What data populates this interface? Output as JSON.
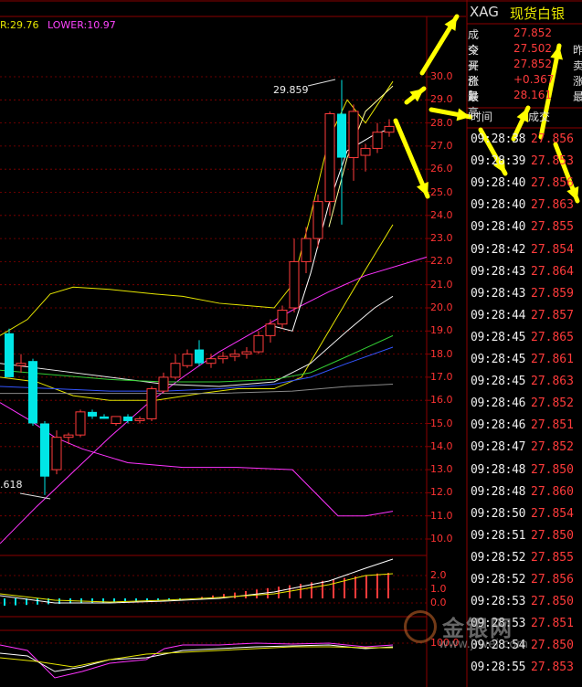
{
  "indicator_legend": {
    "upper": "R:29.76",
    "lower": "LOWER:10.97"
  },
  "header": {
    "code": "XAG",
    "name": "现货白银"
  },
  "quote": [
    {
      "label": "成交",
      "value": "27.852",
      "right": ""
    },
    {
      "label": "今开",
      "value": "27.502",
      "right": "昨"
    },
    {
      "label": "买价1",
      "value": "27.852",
      "right": "卖"
    },
    {
      "label": "涨跌",
      "value": "+0.367",
      "right": "涨"
    },
    {
      "label": "最高",
      "value": "28.161",
      "right": "最"
    }
  ],
  "tick_header": {
    "time": "时间",
    "trade": "成交"
  },
  "ticks": [
    {
      "time": "09:28:38",
      "price": "27.856"
    },
    {
      "time": "09:28:39",
      "price": "27.853"
    },
    {
      "time": "09:28:40",
      "price": "27.856"
    },
    {
      "time": "09:28:40",
      "price": "27.863"
    },
    {
      "time": "09:28:40",
      "price": "27.855"
    },
    {
      "time": "09:28:42",
      "price": "27.854"
    },
    {
      "time": "09:28:43",
      "price": "27.864"
    },
    {
      "time": "09:28:43",
      "price": "27.859"
    },
    {
      "time": "09:28:44",
      "price": "27.857"
    },
    {
      "time": "09:28:45",
      "price": "27.865"
    },
    {
      "time": "09:28:45",
      "price": "27.861"
    },
    {
      "time": "09:28:45",
      "price": "27.863"
    },
    {
      "time": "09:28:46",
      "price": "27.852"
    },
    {
      "time": "09:28:46",
      "price": "27.851"
    },
    {
      "time": "09:28:47",
      "price": "27.852"
    },
    {
      "time": "09:28:48",
      "price": "27.850"
    },
    {
      "time": "09:28:48",
      "price": "27.860"
    },
    {
      "time": "09:28:50",
      "price": "27.854"
    },
    {
      "time": "09:28:51",
      "price": "27.850"
    },
    {
      "time": "09:28:52",
      "price": "27.855"
    },
    {
      "time": "09:28:52",
      "price": "27.856"
    },
    {
      "time": "09:28:53",
      "price": "27.850"
    },
    {
      "time": "09:28:53",
      "price": "27.851"
    },
    {
      "time": "09:28:54",
      "price": "27.850"
    },
    {
      "time": "09:28:55",
      "price": "27.853"
    }
  ],
  "annotations": {
    "high": "29.859",
    "low": ".618"
  },
  "watermark": {
    "text": "金银网",
    "url": "www.jrwei.com"
  },
  "colors": {
    "up": "#ff3b3b",
    "down": "#00e6e6",
    "grid": "#8b0000",
    "arrow": "#ffff00"
  },
  "chart_data": {
    "type": "candlestick",
    "price_ticks": [
      30.0,
      29.0,
      28.0,
      27.0,
      26.0,
      25.0,
      24.0,
      23.0,
      22.0,
      21.0,
      20.0,
      19.0,
      18.0,
      17.0,
      16.0,
      15.0,
      14.0,
      13.0,
      12.0,
      11.0,
      10.0
    ],
    "macd_ticks": [
      2.0,
      1.0,
      0.0
    ],
    "kdj_ticks": [
      100.0
    ],
    "candles": [
      {
        "o": 18.9,
        "h": 19.1,
        "l": 17.2,
        "c": 17.0
      },
      {
        "o": 17.5,
        "h": 18.0,
        "l": 17.2,
        "c": 17.6
      },
      {
        "o": 17.7,
        "h": 17.8,
        "l": 14.9,
        "c": 15.0
      },
      {
        "o": 15.0,
        "h": 15.1,
        "l": 11.9,
        "c": 12.7
      },
      {
        "o": 13.0,
        "h": 14.7,
        "l": 12.8,
        "c": 14.4
      },
      {
        "o": 14.4,
        "h": 14.6,
        "l": 14.1,
        "c": 14.5
      },
      {
        "o": 14.5,
        "h": 15.6,
        "l": 14.4,
        "c": 15.5
      },
      {
        "o": 15.5,
        "h": 15.6,
        "l": 15.2,
        "c": 15.3
      },
      {
        "o": 15.3,
        "h": 15.4,
        "l": 15.2,
        "c": 15.2
      },
      {
        "o": 15.0,
        "h": 15.3,
        "l": 14.9,
        "c": 15.3
      },
      {
        "o": 15.3,
        "h": 15.4,
        "l": 15.0,
        "c": 15.1
      },
      {
        "o": 15.2,
        "h": 15.3,
        "l": 15.0,
        "c": 15.2
      },
      {
        "o": 15.2,
        "h": 16.6,
        "l": 15.1,
        "c": 16.5
      },
      {
        "o": 16.4,
        "h": 17.2,
        "l": 16.3,
        "c": 17.0
      },
      {
        "o": 17.0,
        "h": 18.0,
        "l": 16.9,
        "c": 17.6
      },
      {
        "o": 17.5,
        "h": 18.2,
        "l": 17.4,
        "c": 18.0
      },
      {
        "o": 18.2,
        "h": 18.6,
        "l": 17.5,
        "c": 17.6
      },
      {
        "o": 17.6,
        "h": 18.0,
        "l": 17.4,
        "c": 17.8
      },
      {
        "o": 17.8,
        "h": 18.1,
        "l": 17.6,
        "c": 17.9
      },
      {
        "o": 17.9,
        "h": 18.2,
        "l": 17.7,
        "c": 18.0
      },
      {
        "o": 18.0,
        "h": 18.3,
        "l": 17.8,
        "c": 18.1
      },
      {
        "o": 18.1,
        "h": 19.0,
        "l": 18.0,
        "c": 18.8
      },
      {
        "o": 18.8,
        "h": 19.5,
        "l": 18.5,
        "c": 19.3
      },
      {
        "o": 19.3,
        "h": 20.1,
        "l": 19.1,
        "c": 19.9
      },
      {
        "o": 20.0,
        "h": 23.0,
        "l": 19.8,
        "c": 22.0
      },
      {
        "o": 22.0,
        "h": 23.5,
        "l": 21.5,
        "c": 23.0
      },
      {
        "o": 23.0,
        "h": 24.9,
        "l": 22.6,
        "c": 24.6
      },
      {
        "o": 24.6,
        "h": 28.5,
        "l": 24.0,
        "c": 28.4
      },
      {
        "o": 28.4,
        "h": 29.86,
        "l": 23.6,
        "c": 26.5
      },
      {
        "o": 26.5,
        "h": 28.8,
        "l": 25.5,
        "c": 28.5
      },
      {
        "o": 26.6,
        "h": 27.1,
        "l": 25.9,
        "c": 26.9
      },
      {
        "o": 26.9,
        "h": 28.0,
        "l": 26.7,
        "c": 27.6
      },
      {
        "o": 27.6,
        "h": 28.16,
        "l": 27.4,
        "c": 27.85
      }
    ]
  }
}
